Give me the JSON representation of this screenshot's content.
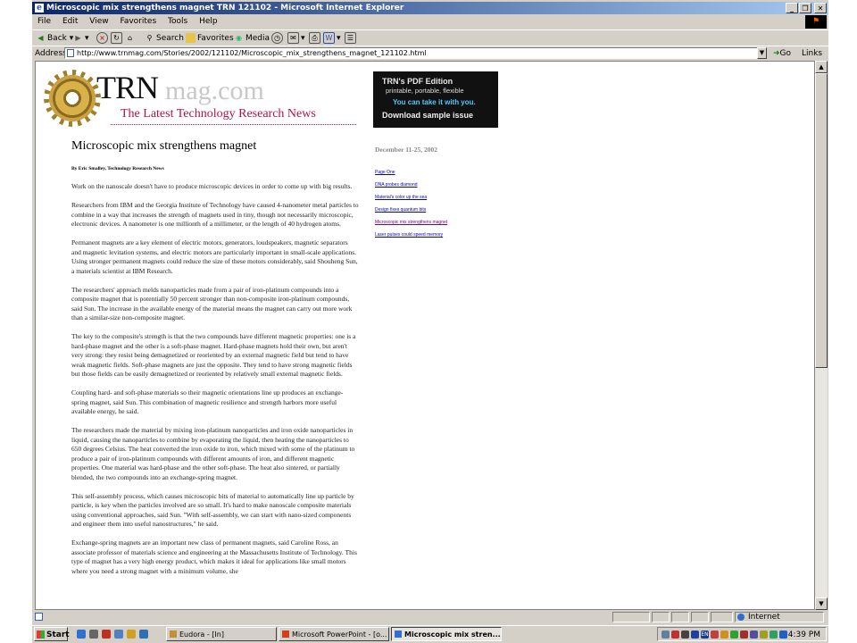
{
  "window": {
    "title": "Microscopic mix strengthens magnet TRN 121102 - Microsoft Internet Explorer",
    "min": "_",
    "max": "❒",
    "close": "✕"
  },
  "menu": [
    "File",
    "Edit",
    "View",
    "Favorites",
    "Tools",
    "Help"
  ],
  "toolbar": {
    "back": "Back",
    "search": "Search",
    "favorites": "Favorites",
    "media": "Media"
  },
  "address": {
    "label": "Address",
    "url": "http://www.trnmag.com/Stories/2002/121102/Microscopic_mix_strengthens_magnet_121102.html",
    "go": "Go",
    "links": "Links"
  },
  "page": {
    "logo_trn": "TRN",
    "logo_mag": "mag.com",
    "logo_tagline": "The Latest Technology Research News",
    "pdf_banner": {
      "line1": "TRN's PDF Edition",
      "line2": "printable, portable, flexible",
      "line3": "You can take it with you.",
      "line4": "Download sample issue"
    },
    "headline": "Microscopic mix strengthens magnet",
    "byline": "By Eric Smalley, Technology Research News",
    "date": "December 11-25, 2002",
    "side_links": [
      "Page One",
      "DNA probes diamond",
      "Material's color up the sea",
      "Design fixes quantum bits",
      "Microscopic mix strengthens magnet",
      "Laser pulses could speed memory"
    ],
    "paragraphs": [
      "Work on the nanoscale doesn't have to produce microscopic devices in order to come up with big results.",
      "Researchers from IBM and the Georgia Institute of Technology have caused 4-nanometer metal particles to combine in a way that increases the strength of magnets used in tiny, though not necessarily microscopic, electronic devices. A nanometer is one millionth of a millimeter, or the length of 40 hydrogen atoms.",
      "Permanent magnets are a key element of electric motors, generators, loudspeakers, magnetic separators and magnetic levitation systems, and electric motors are particularly important in small-scale applications. Using stronger permanent magnets could reduce the size of these motors considerably, said Shouheng Sun, a materials scientist at IBM Research.",
      "The researchers' approach melds nanoparticles made from a pair of iron-platinum compounds into a composite magnet that is potentially 50 percent stronger than non-composite iron-platinum compounds, said Sun. The increase in the available energy of the material means the magnet can carry out more work than a similar-size non-composite magnet.",
      "The key to the composite's strength is that the two compounds have different magnetic properties: one is a hard-phase magnet and the other is a soft-phase magnet. Hard-phase magnets hold their own, but aren't very strong: they resist being demagnetized or reoriented by an external magnetic field but tend to have weak magnetic fields. Soft-phase magnets are just the opposite. They tend to have strong magnetic fields but those fields can be easily demagnetized or reoriented by relatively small external magnetic fields.",
      "Coupling hard- and soft-phase materials so their magnetic orientations line up produces an exchange-spring magnet, said Sun. This combination of magnetic resilience and strength harbors more useful available energy, he said.",
      "The researchers made the material by mixing iron-platinum nanoparticles and iron oxide nanoparticles in liquid, causing the nanoparticles to combine by evaporating the liquid, then heating the nanoparticles to 650 degrees Celsius. The heat converted the iron oxide to iron, which mixed with some of the platinum to produce a pair of iron-platinum compounds with different amounts of iron, and different magnetic properties. One material was hard-phase and the other soft-phase. The heat also sintered, or partially blended, the two compounds into an exchange-spring magnet.",
      "This self-assembly process, which causes microscopic bits of material to automatically line up particle by particle, is key when the particles involved are so small. It's hard to make nanoscale composite materials using conventional approaches, said Sun. \"With self-assembly, we can start with nano-sized components and engineer them into useful nanostructures,\" he said.",
      "Exchange-spring magnets are an important new class of permanent magnets, said Caroline Ross, an associate professor of materials science and engineering at the Massachusetts Institute of Technology. This type of magnet has a very high energy product, which makes it ideal for applications like small motors where you need a strong magnet with a minimum volume, she"
    ]
  },
  "status": {
    "zone": "Internet"
  },
  "taskbar": {
    "start": "Start",
    "tasks": [
      "Eudora - [In]",
      "Microsoft PowerPoint - [o...",
      "Microscopic mix stren..."
    ],
    "clock": "4:39 PM"
  }
}
